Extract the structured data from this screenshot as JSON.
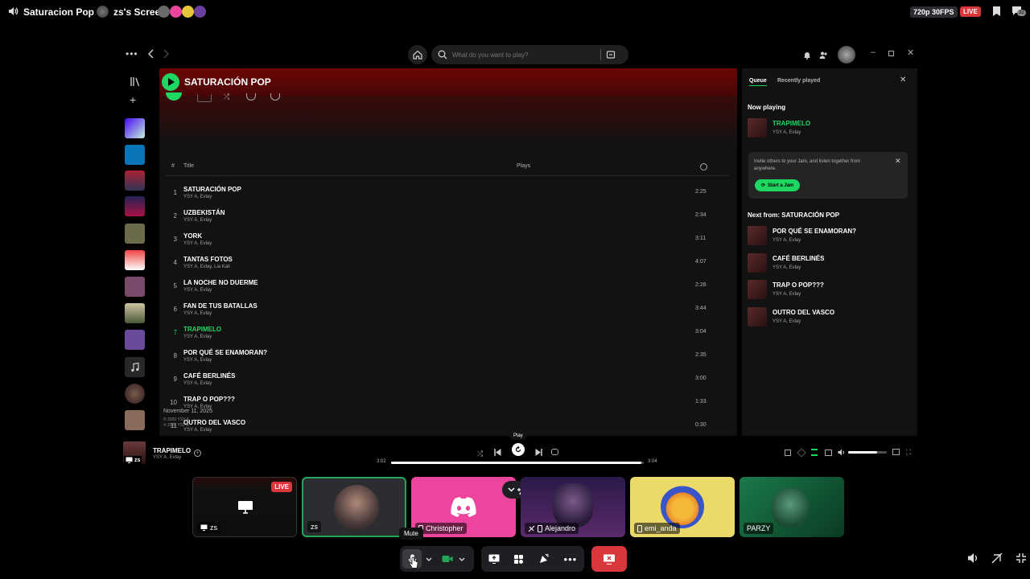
{
  "top_bar": {
    "call_name": "Saturacion Pop",
    "separator": "·",
    "screen_title": "zs's Screen",
    "resolution": "720p 30FPS",
    "live": "LIVE",
    "participant_count": "32"
  },
  "spotify": {
    "search_placeholder": "What do you want to play?",
    "playlist_title": "SATURACIÓN POP",
    "columns": {
      "number": "#",
      "title": "Title",
      "plays": "Plays"
    },
    "tracks": [
      {
        "n": "1",
        "title": "SATURACIÓN POP",
        "artists": "YSY A, Evlay",
        "duration": "2:25"
      },
      {
        "n": "2",
        "title": "UZBEKISTÁN",
        "artists": "YSY A, Evlay",
        "duration": "2:34"
      },
      {
        "n": "3",
        "title": "YORK",
        "artists": "YSY A, Evlay",
        "duration": "3:11"
      },
      {
        "n": "4",
        "title": "TANTAS FOTOS",
        "artists": "YSY A, Evlay, Lia Kali",
        "duration": "4:07"
      },
      {
        "n": "5",
        "title": "LA NOCHE NO DUERME",
        "artists": "YSY A, Evlay",
        "duration": "2:28"
      },
      {
        "n": "6",
        "title": "FAN DE TUS BATALLAS",
        "artists": "YSY A, Evlay",
        "duration": "3:44"
      },
      {
        "n": "7",
        "title": "TRAPIMELO",
        "artists": "YSY A, Evlay",
        "duration": "3:04"
      },
      {
        "n": "8",
        "title": "POR QUÉ SE ENAMORAN?",
        "artists": "YSY A, Evlay",
        "duration": "2:35"
      },
      {
        "n": "9",
        "title": "CAFÉ BERLINÉS",
        "artists": "YSY A, Evlay",
        "duration": "3:00"
      },
      {
        "n": "10",
        "title": "TRAP O POP???",
        "artists": "YSY A, Evlay",
        "duration": "1:33"
      },
      {
        "n": "11",
        "title": "OUTRO DEL VASCO",
        "artists": "YSY A, Evlay",
        "duration": "0:30"
      }
    ],
    "playing_index": 6,
    "release_date": "November 11, 2025",
    "copyright_1": "© 2025 YSY A",
    "copyright_2": "℗ 2025 YSY A",
    "queue": {
      "tab_queue": "Queue",
      "tab_recent": "Recently played",
      "now_playing_label": "Now playing",
      "now_playing_title": "TRAPIMELO",
      "now_playing_artists": "YSY A, Evlay",
      "jam_text": "Invite others to your Jam, and listen together from anywhere.",
      "jam_button": "Start a Jam",
      "next_from_label": "Next from: SATURACIÓN POP",
      "next": [
        {
          "title": "POR QUÉ SE ENAMORAN?",
          "artists": "YSY A, Evlay"
        },
        {
          "title": "CAFÉ BERLINÉS",
          "artists": "YSY A, Evlay"
        },
        {
          "title": "TRAP O POP???",
          "artists": "YSY A, Evlay"
        },
        {
          "title": "OUTRO DEL VASCO",
          "artists": "YSY A, Evlay"
        }
      ]
    },
    "player": {
      "title": "TRAPIMELO",
      "artists": "YSY A, Evlay",
      "elapsed": "3:02",
      "total": "3:04",
      "progress": 0.99,
      "volume": 0.75,
      "tooltip": "Play"
    }
  },
  "call": {
    "tiles": [
      {
        "name": "zs",
        "type": "screen",
        "live": "LIVE"
      },
      {
        "name": "zs",
        "type": "camera"
      },
      {
        "name": "Christopher",
        "type": "discord"
      },
      {
        "name": "Alejandro",
        "type": "camera"
      },
      {
        "name": "emi_anda",
        "type": "avatar"
      },
      {
        "name": "PARZY",
        "type": "camera"
      }
    ],
    "mute_tooltip": "Mute",
    "screen_label": "zs"
  },
  "colors": {
    "spotify_green": "#1ed760",
    "discord_red": "#da373c",
    "discord_pink": "#eb459e"
  }
}
